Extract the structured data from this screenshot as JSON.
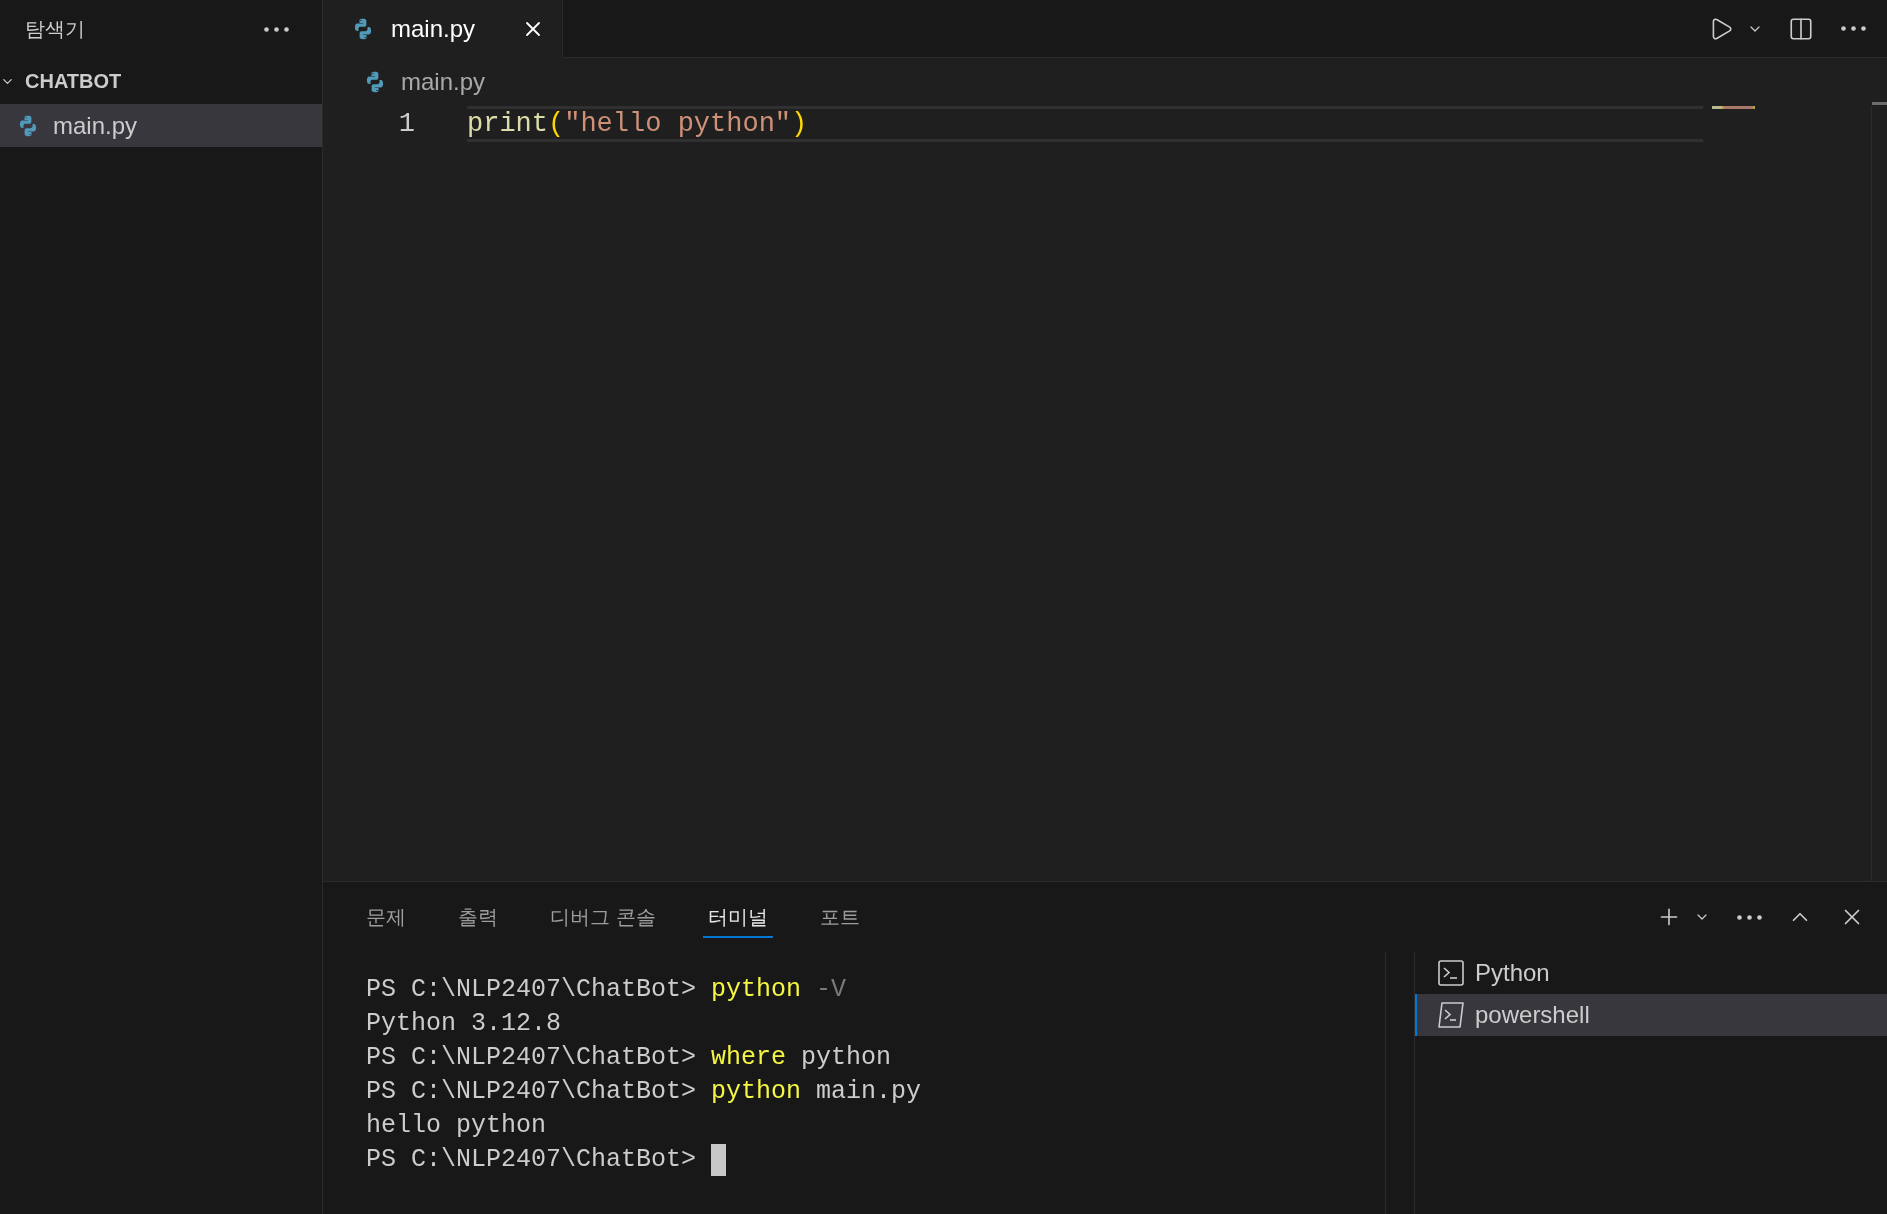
{
  "sidebar": {
    "title": "탐색기",
    "folder": {
      "name": "CHATBOT",
      "expanded": true,
      "children": [
        {
          "name": "main.py",
          "selected": true
        }
      ]
    }
  },
  "editor": {
    "tabs": [
      {
        "label": "main.py",
        "selected": true
      }
    ],
    "breadcrumb": [
      "main.py"
    ],
    "lines": [
      {
        "number": "1",
        "current": true,
        "tokens": [
          {
            "kind": "function",
            "text": "print"
          },
          {
            "kind": "bracket",
            "text": "("
          },
          {
            "kind": "string",
            "text": "\"hello python\""
          },
          {
            "kind": "bracket",
            "text": ")"
          }
        ]
      }
    ]
  },
  "panel": {
    "tabs": [
      {
        "label": "문제",
        "selected": false
      },
      {
        "label": "출력",
        "selected": false
      },
      {
        "label": "디버그 콘솔",
        "selected": false
      },
      {
        "label": "터미널",
        "selected": true
      },
      {
        "label": "포트",
        "selected": false
      }
    ],
    "terminal": {
      "lines": [
        {
          "cursor": false,
          "segments": [
            {
              "kind": "prompt",
              "text": "PS C:\\NLP2407\\ChatBot>"
            },
            {
              "kind": "command",
              "text": "python"
            },
            {
              "kind": "flag",
              "text": "-V"
            }
          ]
        },
        {
          "cursor": false,
          "segments": [
            {
              "kind": "output",
              "text": "Python 3.12.8"
            }
          ]
        },
        {
          "cursor": false,
          "segments": [
            {
              "kind": "prompt",
              "text": "PS C:\\NLP2407\\ChatBot>"
            },
            {
              "kind": "command",
              "text": "where"
            },
            {
              "kind": "argument",
              "text": "python"
            }
          ]
        },
        {
          "cursor": false,
          "segments": [
            {
              "kind": "prompt",
              "text": "PS C:\\NLP2407\\ChatBot>"
            },
            {
              "kind": "command",
              "text": "python"
            },
            {
              "kind": "argument",
              "text": "main.py"
            }
          ]
        },
        {
          "cursor": false,
          "segments": [
            {
              "kind": "output",
              "text": "hello python"
            }
          ]
        },
        {
          "cursor": true,
          "segments": [
            {
              "kind": "prompt",
              "text": "PS C:\\NLP2407\\ChatBot>"
            }
          ]
        }
      ]
    },
    "sessions": [
      {
        "kind": "terminal",
        "label": "Python",
        "selected": false
      },
      {
        "kind": "powershell",
        "label": "powershell",
        "selected": true
      }
    ]
  }
}
